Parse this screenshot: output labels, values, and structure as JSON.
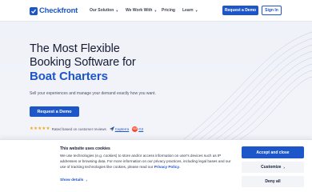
{
  "header": {
    "brand": "Checkfront",
    "nav": [
      {
        "label": "Our Solution"
      },
      {
        "label": "We Work With"
      },
      {
        "label": "Pricing"
      },
      {
        "label": "Learn"
      }
    ],
    "request_demo": "Request a Demo",
    "sign_in": "Sign In"
  },
  "hero": {
    "line1": "The Most Flexible",
    "line2": "Booking Software for",
    "accent": "Boat Charters",
    "subtext": "Sell your experiences and manage your demand exactly how you want.",
    "cta": "Request a Demo",
    "rating": {
      "stars": "★★★★★",
      "text": "Rated based on customer reviews",
      "capterra": "Capterra",
      "g2_badge": "G2",
      "g2": "G2"
    }
  },
  "cookie": {
    "title": "This website uses cookies",
    "body": "We use technologies (e.g. cookies) to store and/or access information on user's devices such as IP addresses or browsing data. For more information on our privacy practices, including legal bases and our use of tracking technologies like cookies, please read our ",
    "privacy_link": "Privacy Policy.",
    "show_details": "Show details",
    "accept": "Accept and close",
    "customize": "Customize",
    "deny": "Deny all"
  },
  "colors": {
    "brand": "#1d56c8",
    "star": "#f3a712",
    "g2": "#ff492c"
  }
}
